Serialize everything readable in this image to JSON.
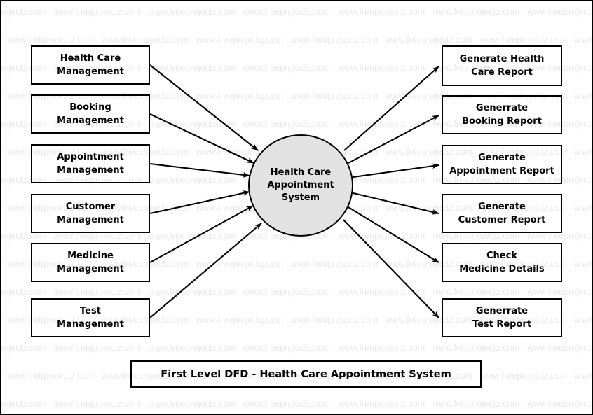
{
  "diagram": {
    "title": "First Level DFD - Health Care Appointment System",
    "type": "data-flow-diagram",
    "level": "First Level DFD",
    "process": {
      "label": "Health Care\nAppointment\nSystem",
      "fill_color": "#e2e2e2",
      "border_color": "#000000"
    },
    "inputs": [
      {
        "label": "Health Care\nManagement"
      },
      {
        "label": "Booking\nManagement"
      },
      {
        "label": "Appointment\nManagement"
      },
      {
        "label": "Customer\nManagement"
      },
      {
        "label": "Medicine\nManagement"
      },
      {
        "label": "Test\nManagement"
      }
    ],
    "outputs": [
      {
        "label": "Generate Health\nCare Report"
      },
      {
        "label": "Generrate\nBooking Report"
      },
      {
        "label": "Generate\nAppointment Report"
      },
      {
        "label": "Generate\nCustomer Report"
      },
      {
        "label": "Check\nMedicine Details"
      },
      {
        "label": "Generrate\nTest Report"
      }
    ],
    "watermark": {
      "text": "www.freeprojectz.com",
      "color": "#e9e9e9"
    },
    "colors": {
      "line": "#000000",
      "background": "#ffffff",
      "text": "#000000"
    }
  }
}
